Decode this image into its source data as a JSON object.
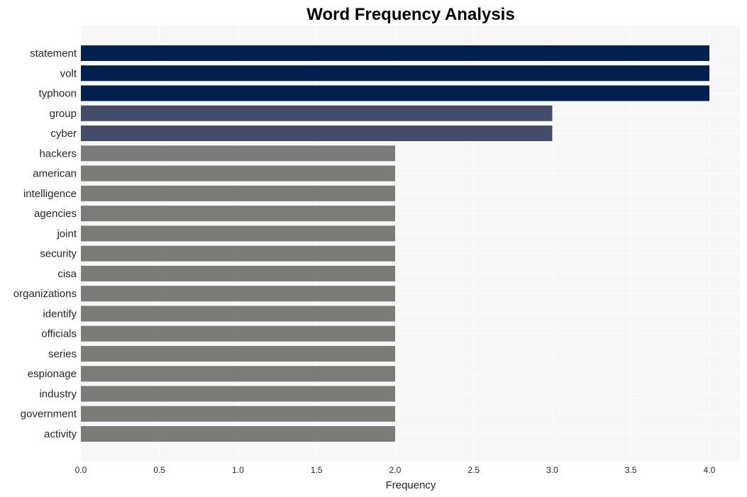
{
  "chart_data": {
    "type": "bar",
    "orientation": "horizontal",
    "title": "Word Frequency Analysis",
    "xlabel": "Frequency",
    "ylabel": "",
    "xlim": [
      0,
      4.2
    ],
    "xticks": [
      "0.0",
      "0.5",
      "1.0",
      "1.5",
      "2.0",
      "2.5",
      "3.0",
      "3.5",
      "4.0"
    ],
    "xtick_values": [
      0,
      0.5,
      1.0,
      1.5,
      2.0,
      2.5,
      3.0,
      3.5,
      4.0
    ],
    "grid": true,
    "categories": [
      "statement",
      "volt",
      "typhoon",
      "group",
      "cyber",
      "hackers",
      "american",
      "intelligence",
      "agencies",
      "joint",
      "security",
      "cisa",
      "organizations",
      "identify",
      "officials",
      "series",
      "espionage",
      "industry",
      "government",
      "activity"
    ],
    "values": [
      4,
      4,
      4,
      3,
      3,
      2,
      2,
      2,
      2,
      2,
      2,
      2,
      2,
      2,
      2,
      2,
      2,
      2,
      2,
      2
    ],
    "colors": {
      "4": "#00204e",
      "3": "#434d6b",
      "2": "#7c7b78"
    },
    "background": "#f7f7f7"
  }
}
